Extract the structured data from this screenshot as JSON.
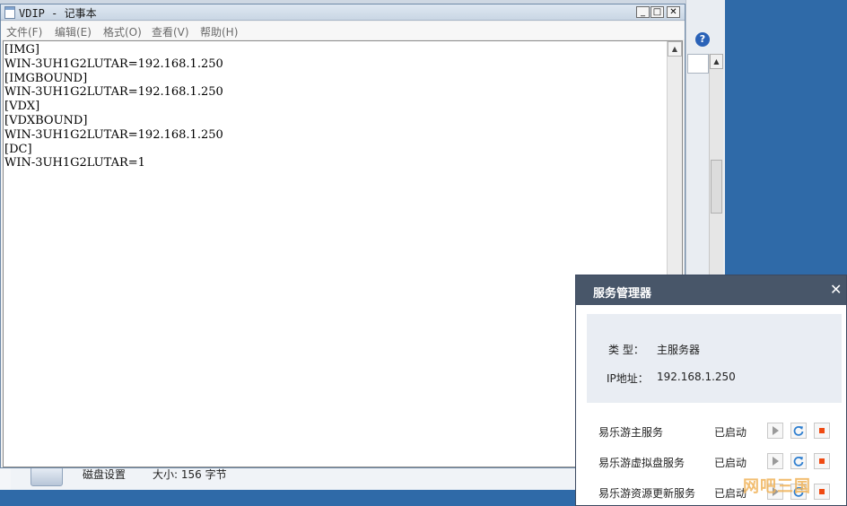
{
  "notepad": {
    "title": "VDIP - 记事本",
    "menu": [
      "文件(F)",
      "编辑(E)",
      "格式(O)",
      "查看(V)",
      "帮助(H)"
    ],
    "lines": [
      "[IMG]",
      "WIN-3UH1G2LUTAR=192.168.1.250",
      "[IMGBOUND]",
      "WIN-3UH1G2LUTAR=192.168.1.250",
      "[VDX]",
      "[VDXBOUND]",
      "WIN-3UH1G2LUTAR=192.168.1.250",
      "[DC]",
      "WIN-3UH1G2LUTAR=1"
    ],
    "controls": {
      "minimize": "_",
      "maximize": "□",
      "close": "✕"
    }
  },
  "background": {
    "status_label": "磁盘设置",
    "status_size": "大小: 156 字节",
    "help_icon": "?"
  },
  "service_manager": {
    "title": "服务管理器",
    "close": "✕",
    "type_label": "类  型：",
    "type_value": "主服务器",
    "ip_label": "IP地址：",
    "ip_value": "192.168.1.250",
    "services": [
      {
        "name": "易乐游主服务",
        "status": "已启动"
      },
      {
        "name": "易乐游虚拟盘服务",
        "status": "已启动"
      },
      {
        "name": "易乐游资源更新服务",
        "status": "已启动"
      }
    ],
    "colors": {
      "header": "#485669",
      "start": "#9a9a9a",
      "restart": "#2f7fd0",
      "stop": "#ef4a12"
    }
  },
  "watermark": "网吧三国"
}
